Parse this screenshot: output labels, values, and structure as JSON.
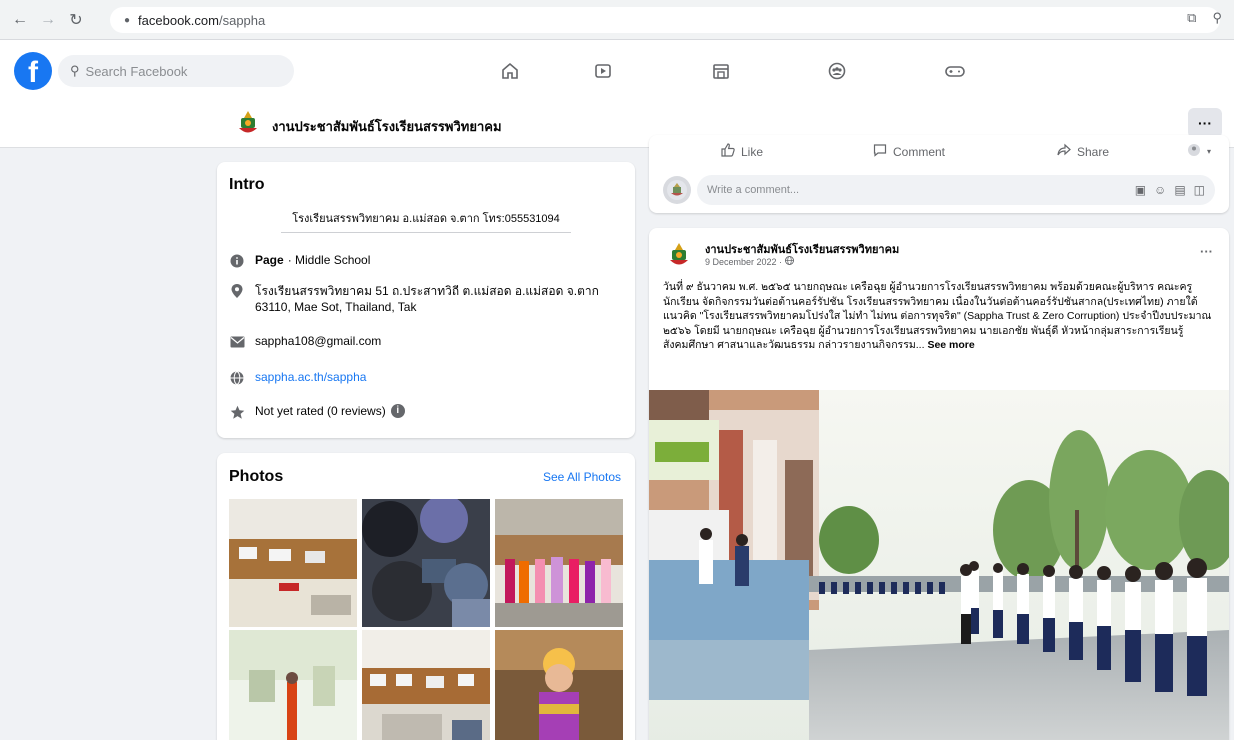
{
  "browser": {
    "url_host": "facebook.com",
    "url_path": "/sappha"
  },
  "fb": {
    "logo": "f",
    "search_placeholder": "Search Facebook"
  },
  "page": {
    "title": "งานประชาสัมพันธ์โรงเรียนสรรพวิทยาคม"
  },
  "intro": {
    "heading": "Intro",
    "bio": "โรงเรียนสรรพวิทยาคม อ.แม่สอด จ.ตาก โทร:055531094",
    "category_label": "Page",
    "category_value": " · Middle School",
    "address": "โรงเรียนสรรพวิทยาคม 51 ถ.ประสาทวิถี ต.แม่สอด อ.แม่สอด จ.ตาก 63110, Mae Sot, Thailand, Tak",
    "email": "sappha108@gmail.com",
    "website": "sappha.ac.th/sappha",
    "rating": "Not yet rated (0 reviews)"
  },
  "photos": {
    "heading": "Photos",
    "see_all": "See All Photos"
  },
  "actions": {
    "like": "Like",
    "comment": "Comment",
    "share": "Share",
    "comment_placeholder": "Write a comment..."
  },
  "post": {
    "author": "งานประชาสัมพันธ์โรงเรียนสรรพวิทยาคม",
    "time": "9 December 2022 · ",
    "text": "วันที่ ๙ ธันวาคม พ.ศ. ๒๕๖๕ นายกฤษณะ เครือฉุย ผู้อำนวยการโรงเรียนสรรพวิทยาคม พร้อมด้วยคณะผู้บริหาร คณะครู นักเรียน จัดกิจกรรมวันต่อต้านคอร์รัปชัน โรงเรียนสรรพวิทยาคม เนื่องในวันต่อต้านคอร์รัปชันสากล(ประเทศไทย) ภายใต้แนวคิด \"โรงเรียนสรรพวิทยาคมโปร่งใส ไม่ทำ ไม่ทน ต่อการทุจริต\" (Sappha Trust & Zero Corruption) ประจำปีงบประมาณ ๒๕๖๖ โดยมี นายกฤษณะ เครือฉุย ผู้อำนวยการโรงเรียนสรรพวิทยาคม นายเอกชัย พันธุ์ดี หัวหน้ากลุ่มสาระการเรียนรู้สังคมศึกษา ศาสนาและวัฒนธรรม กล่าวรายงานกิจกรรม...",
    "see_more": "See more"
  }
}
